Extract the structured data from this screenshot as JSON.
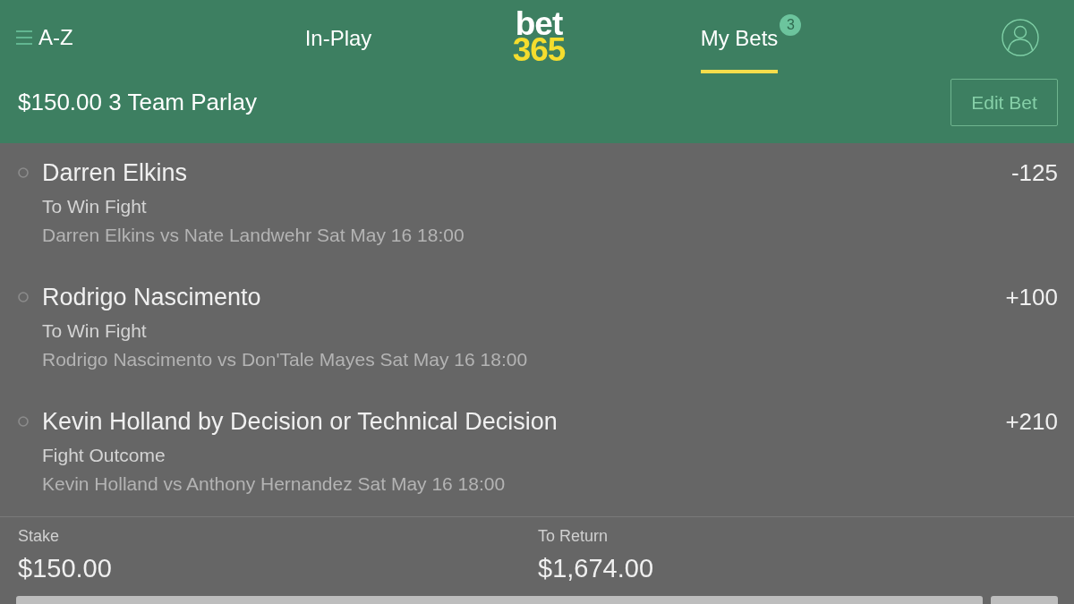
{
  "nav": {
    "menu": {
      "label": "A-Z"
    },
    "tabs": [
      {
        "label": "In-Play",
        "selected": false
      },
      {
        "label": "My Bets",
        "selected": true,
        "badge": "3"
      }
    ],
    "logo": {
      "line_1": "bet",
      "line_2": "365"
    }
  },
  "bet_header": {
    "title": "$150.00 3 Team Parlay",
    "edit_button": "Edit Bet"
  },
  "selections": [
    {
      "name": "Darren Elkins",
      "odds": "-125",
      "market": "To Win Fight",
      "event": "Darren Elkins vs Nate Landwehr Sat May 16 18:00"
    },
    {
      "name": "Rodrigo Nascimento",
      "odds": "+100",
      "market": "To Win Fight",
      "event": "Rodrigo Nascimento vs Don'Tale Mayes Sat May 16 18:00"
    },
    {
      "name": "Kevin Holland by Decision or Technical Decision",
      "odds": "+210",
      "market": "Fight Outcome",
      "event": "Kevin Holland vs Anthony Hernandez Sat May 16 18:00"
    }
  ],
  "summary": {
    "stake_label": "Stake",
    "stake": "$150.00",
    "return_label": "To Return",
    "return": "$1,674.00"
  }
}
